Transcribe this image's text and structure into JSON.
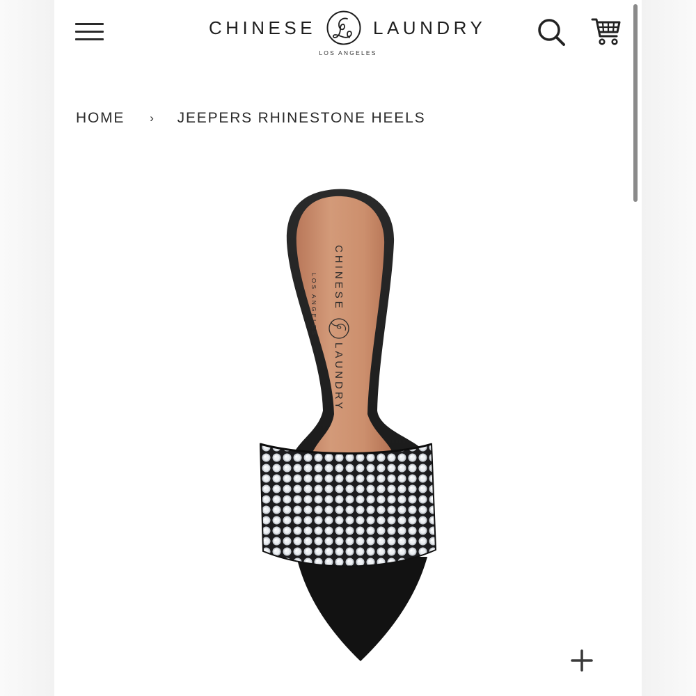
{
  "header": {
    "brand_left": "CHINESE",
    "brand_right": "LAUNDRY",
    "brand_sub": "LOS ANGELES",
    "menu_icon": "hamburger-menu-icon",
    "search_icon": "search-icon",
    "cart_icon": "cart-icon"
  },
  "breadcrumb": {
    "home": "HOME",
    "separator": "›",
    "current": "JEEPERS RHINESTONE HEELS"
  },
  "product": {
    "insole_brand_top": "CHINESE",
    "insole_brand_bottom": "LAUNDRY",
    "insole_sub": "LOS ANGELES",
    "zoom_icon": "plus-icon"
  },
  "colors": {
    "text": "#2b2b2b",
    "shoe_black": "#141414",
    "insole_tan": "#c98a68",
    "rhinestone": "#d9dde2"
  }
}
